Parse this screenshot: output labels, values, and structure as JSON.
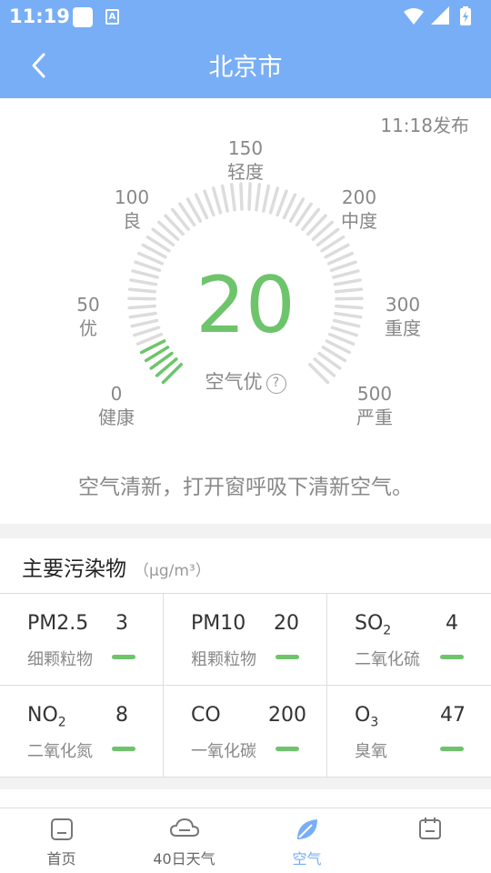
{
  "status_bar": {
    "time": "11:19",
    "app_icon_letter": "A",
    "icons": [
      "notification-square-icon",
      "a-icon",
      "wifi-icon",
      "signal-icon",
      "battery-charging-icon"
    ]
  },
  "app_bar": {
    "title": "北京市",
    "back_icon": "back-arrow-icon"
  },
  "air_quality": {
    "publish_time": "11:18发布",
    "aqi": "20",
    "level": "空气优",
    "help_icon": "?",
    "advice": "空气清新，打开窗呼吸下清新空气。",
    "accent_color": "#6ec46b",
    "gauge_fill": 0.04,
    "scale_labels": [
      {
        "value": "0",
        "label": "健康"
      },
      {
        "value": "50",
        "label": "优"
      },
      {
        "value": "100",
        "label": "良"
      },
      {
        "value": "150",
        "label": "轻度"
      },
      {
        "value": "200",
        "label": "中度"
      },
      {
        "value": "300",
        "label": "重度"
      },
      {
        "value": "500",
        "label": "严重"
      }
    ]
  },
  "pollutants": {
    "title": "主要污染物",
    "unit": "（μg/m³）",
    "items": [
      {
        "name": "PM2.5",
        "value": "3",
        "desc": "细颗粒物"
      },
      {
        "name": "PM10",
        "value": "20",
        "desc": "粗颗粒物"
      },
      {
        "name": "SO",
        "sub": "2",
        "value": "4",
        "desc": "二氧化硫"
      },
      {
        "name": "NO",
        "sub": "2",
        "value": "8",
        "desc": "二氧化氮"
      },
      {
        "name": "CO",
        "value": "200",
        "desc": "一氧化碳"
      },
      {
        "name": "O",
        "sub": "3",
        "value": "47",
        "desc": "臭氧"
      }
    ]
  },
  "tab_bar": {
    "active_color": "#78aef5",
    "tabs": [
      {
        "label": "首页",
        "icon": "home-icon"
      },
      {
        "label": "40日天气",
        "icon": "cloud-icon"
      },
      {
        "label": "空气",
        "icon": "leaf-icon",
        "active": true
      },
      {
        "label": "",
        "icon": "calendar-icon"
      }
    ]
  }
}
